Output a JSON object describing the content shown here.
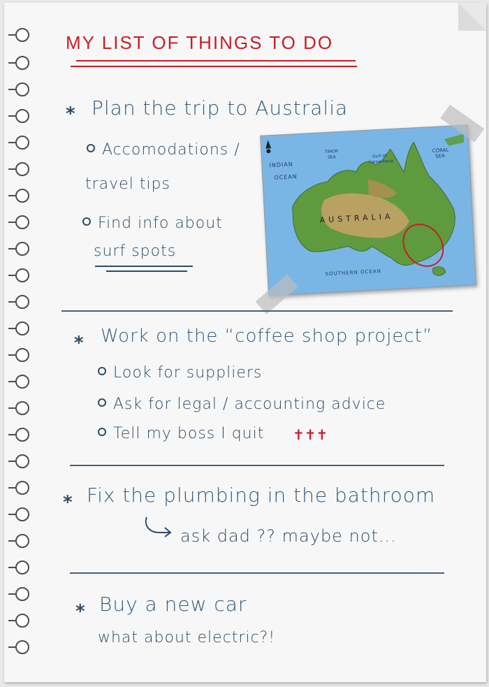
{
  "title": "MY LIST OF THINGS TO DO",
  "sections": [
    {
      "heading": "Plan the trip to Australia",
      "items": [
        {
          "text": "Accomodations /"
        },
        {
          "text": "travel tips"
        },
        {
          "text": "Find info about"
        },
        {
          "text": "surf spots"
        }
      ]
    },
    {
      "heading": "Work on the “coffee shop project”",
      "items": [
        {
          "text": "Look for suppliers"
        },
        {
          "text": "Ask for legal / accounting advice"
        },
        {
          "text": "Tell my boss I quit"
        }
      ],
      "mark": "✝✝✝"
    },
    {
      "heading": "Fix the plumbing in the bathroom",
      "note": "ask dad ?? maybe not..."
    },
    {
      "heading": "Buy a new car",
      "note": "what about electric?!"
    }
  ],
  "map": {
    "country": "AUSTRALIA",
    "indian_ocean": "INDIAN",
    "indian_ocean_2": "OCEAN",
    "southern_ocean": "SOUTHERN OCEAN",
    "coral_sea": "CORAL",
    "coral_sea_2": "SEA",
    "timor_sea": "TIMOR",
    "timor_sea_2": "SEA",
    "gulf": "Gulf of",
    "gulf_2": "Carpentaria"
  },
  "colors": {
    "title": "#c91d25",
    "ink": "#2f4b66",
    "paper": "#f7f7f7",
    "ocean": "#79b6e6",
    "land_green": "#5f9a3f",
    "land_brown": "#c9a26b"
  }
}
